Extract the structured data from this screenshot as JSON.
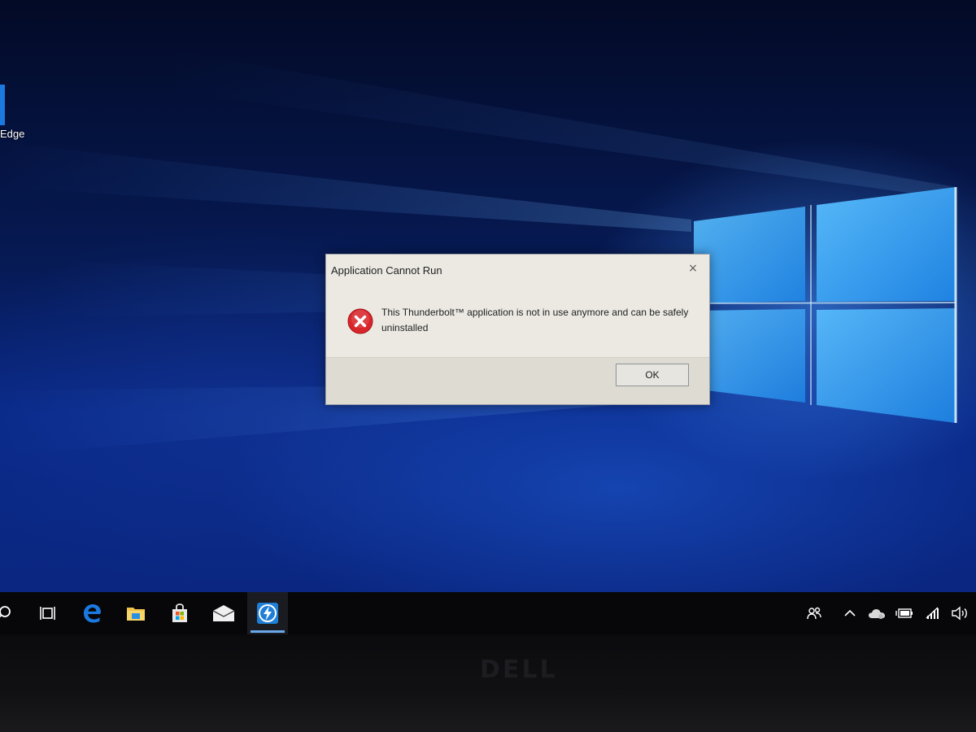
{
  "desktop": {
    "icons": [
      {
        "label": "Edge"
      }
    ]
  },
  "dialog": {
    "title": "Application Cannot Run",
    "close_label": "×",
    "icon": "error-icon",
    "message": "This Thunderbolt™ application is not in use anymore and can be safely uninstalled",
    "ok_label": "OK"
  },
  "taskbar": {
    "items": [
      {
        "icon": "search-icon"
      },
      {
        "icon": "task-view-icon"
      },
      {
        "icon": "edge-icon"
      },
      {
        "icon": "file-explorer-icon"
      },
      {
        "icon": "store-icon"
      },
      {
        "icon": "mail-icon"
      },
      {
        "icon": "thunderbolt-icon",
        "active": true
      }
    ],
    "tray": [
      {
        "icon": "people-icon"
      },
      {
        "icon": "chevron-up-icon"
      },
      {
        "icon": "onedrive-icon"
      },
      {
        "icon": "battery-icon"
      },
      {
        "icon": "wifi-icon"
      },
      {
        "icon": "volume-icon"
      }
    ]
  },
  "bezel": {
    "brand": "DELL"
  },
  "colors": {
    "accent": "#69a7e8",
    "error_red": "#d8262b",
    "edge_blue": "#1b79e0"
  }
}
